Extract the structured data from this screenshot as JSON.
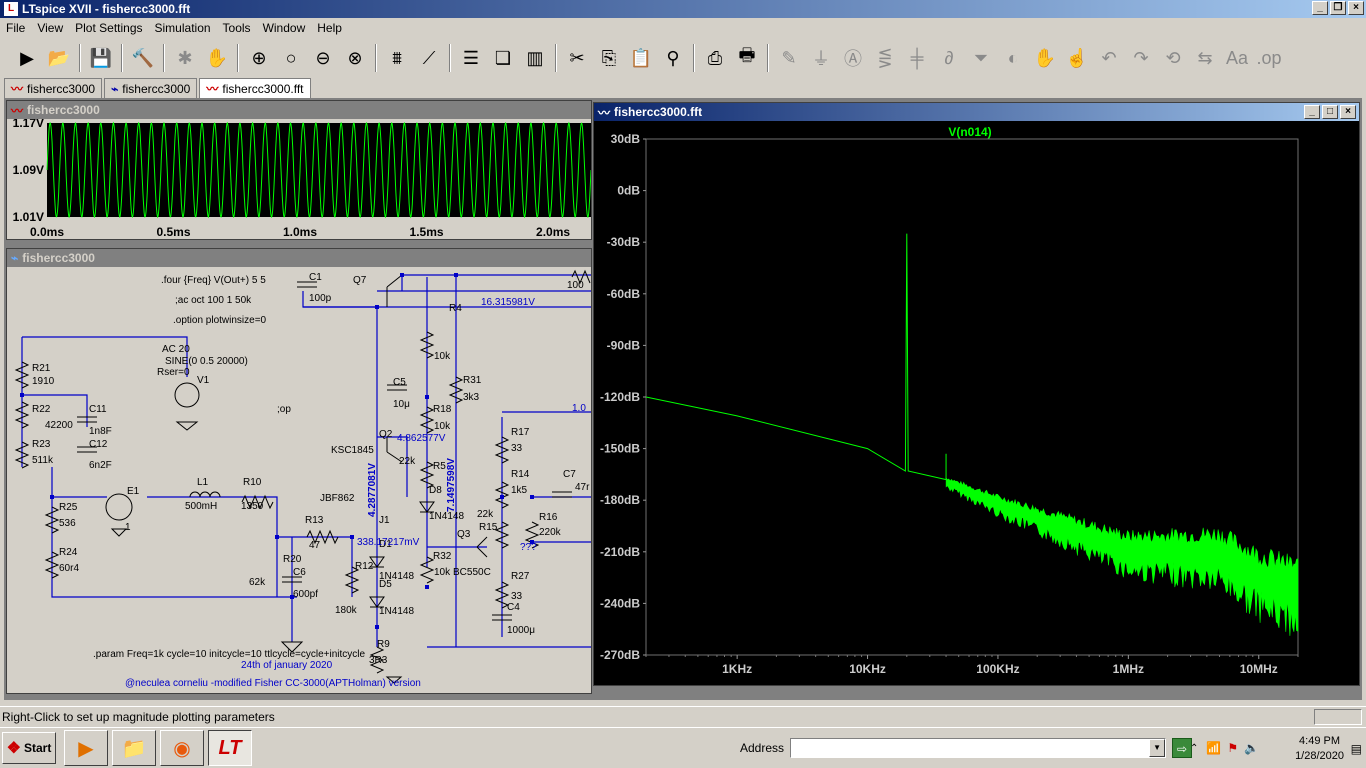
{
  "app": {
    "title": "LTspice XVII - fishercc3000.fft",
    "icon": "ltspice-icon"
  },
  "menu": [
    "File",
    "View",
    "Plot Settings",
    "Simulation",
    "Tools",
    "Window",
    "Help"
  ],
  "toolbar_icons": [
    "run-icon",
    "open-icon",
    "save-icon",
    "control-panel-icon",
    "halt-icon",
    "pan-icon",
    "zoom-in-icon",
    "zoom-fit-icon",
    "zoom-out-icon",
    "zoom-cancel-icon",
    "autorange-icon",
    "cursor-icon",
    "tile-horizontal-icon",
    "cascade-icon",
    "tile-vertical-icon",
    "cut-icon",
    "copy-icon",
    "paste-icon",
    "find-icon",
    "print-setup-icon",
    "print-icon",
    "draw-wire-icon",
    "ground-icon",
    "label-icon",
    "resistor-icon",
    "capacitor-icon",
    "inductor-icon",
    "diode-icon",
    "component-icon",
    "move-icon",
    "drag-icon",
    "undo-icon",
    "redo-icon",
    "rotate-icon",
    "mirror-icon",
    "text-icon",
    "spice-directive-icon"
  ],
  "tabs": [
    {
      "label": "fishercc3000",
      "icon": "waveform-icon"
    },
    {
      "label": "fishercc3000",
      "icon": "schematic-icon"
    },
    {
      "label": "fishercc3000.fft",
      "icon": "waveform-icon"
    }
  ],
  "wave_window": {
    "title": "fishercc3000",
    "y_ticks": [
      "1.17V",
      "1.09V",
      "1.01V"
    ],
    "x_ticks": [
      "0.0ms",
      "0.5ms",
      "1.0ms",
      "1.5ms",
      "2.0ms"
    ],
    "trace_color": "#00ff00"
  },
  "schematic_window": {
    "title": "fishercc3000",
    "directives": [
      ".four {Freq} V(Out+) 5 5",
      ";ac oct 100 1 50k",
      ".option plotwinsize=0",
      ".param Freq=1k cycle=10 initcycle=10 ttlcycle=cycle+initcycle",
      ";op"
    ],
    "source": [
      "AC 20",
      "SINE(0 0.5 20000)",
      "Rser=0"
    ],
    "notes": [
      "24th of january 2020",
      "@neculea corneliu -modified Fisher CC-3000(APTHolman) version"
    ],
    "labels": [
      "C1",
      "100p",
      "Q7",
      "16.315981V",
      "R21",
      "1910",
      "R22",
      "42200",
      "C11",
      "1n8F",
      "R23",
      "511k",
      "C12",
      "6n2F",
      "V1",
      "E1",
      "1",
      "L1",
      "500mH",
      "R10",
      "1350",
      "R25",
      "536",
      "R24",
      "60r4",
      "R13",
      "47",
      "R20",
      "62k",
      "C6",
      "600pf",
      "R12",
      "180k",
      "J1",
      "JBF862",
      "KSC1845",
      "Q2",
      "4.862577V",
      "4.2877081V",
      "7.1497598V",
      "R4",
      "10k",
      "C5",
      "10μ",
      "R18",
      "10k",
      "R31",
      "3k3",
      "R5",
      "22k",
      "D8",
      "1N4148",
      "D1",
      "D5",
      "1N4148",
      "1N4148",
      "R32",
      "10k",
      "BC550C",
      "Q3",
      "R15",
      "22k",
      "R16",
      "220k",
      "???",
      "R27",
      "33",
      "C4",
      "1000μ",
      "R17",
      "33",
      "R14",
      "1k5",
      "C7",
      "47r",
      "R9",
      "3R3",
      "100",
      "338.17217mV",
      "1.0"
    ]
  },
  "fft_window": {
    "title": "fishercc3000.fft",
    "trace_label": "V(n014)",
    "y_ticks": [
      "30dB",
      "0dB",
      "-30dB",
      "-60dB",
      "-90dB",
      "-120dB",
      "-150dB",
      "-180dB",
      "-210dB",
      "-240dB",
      "-270dB"
    ],
    "x_ticks": [
      "1KHz",
      "10KHz",
      "100KHz",
      "1MHz",
      "10MHz"
    ],
    "trace_color": "#00ff00"
  },
  "status": "Right-Click to set up magnitude plotting parameters",
  "taskbar": {
    "start": "Start",
    "address_label": "Address",
    "address_value": "",
    "time": "4:49 PM",
    "date": "1/28/2020"
  },
  "chart_data": [
    {
      "type": "line",
      "title": "",
      "xlabel": "",
      "ylabel": "",
      "x_range_ms": [
        0,
        2.15
      ],
      "ylim": [
        1.01,
        1.17
      ],
      "series": [
        {
          "frequency_hz": 20000,
          "min": 1.01,
          "max": 1.17
        }
      ]
    },
    {
      "type": "line",
      "title": "V(n014)",
      "xlabel": "",
      "ylabel": "",
      "x_scale": "log",
      "x_range_hz": [
        200,
        20000000
      ],
      "ylim": [
        -270,
        30
      ],
      "series": [
        {
          "name": "V(n014)",
          "x": [
            200,
            1000,
            10000,
            19500,
            20000,
            20500,
            40000,
            100000,
            1000000,
            5000000,
            10000000,
            20000000
          ],
          "y": [
            -120,
            -131,
            -150,
            -163,
            -25,
            -163,
            -168,
            -180,
            -205,
            -205,
            -218,
            -225
          ]
        }
      ]
    }
  ]
}
